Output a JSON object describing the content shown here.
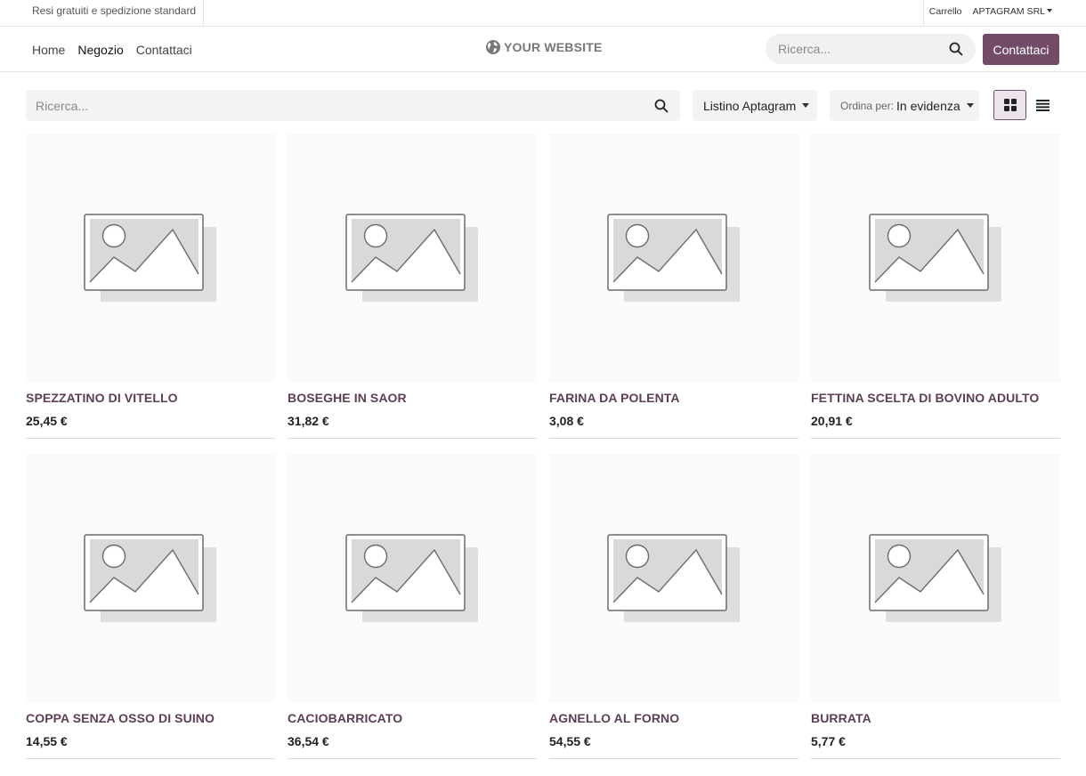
{
  "topbar": {
    "promo": "Resi gratuiti e spedizione standard",
    "cart_link": "Carrello",
    "company": "APTAGRAM SRL"
  },
  "header": {
    "nav": [
      "Home",
      "Negozio",
      "Contattaci"
    ],
    "active_nav": "Negozio",
    "logo_text": "YOUR WEBSITE",
    "search_placeholder": "Ricerca...",
    "contact_button": "Contattaci"
  },
  "toolbar": {
    "search_placeholder": "Ricerca...",
    "pricelist": "Listino Aptagram",
    "sort_label": "Ordina per:",
    "sort_value": "In evidenza",
    "view_mode": "grid"
  },
  "products": [
    {
      "name": "SPEZZATINO DI VITELLO",
      "price": "25,45 €"
    },
    {
      "name": "BOSEGHE IN SAOR",
      "price": "31,82 €"
    },
    {
      "name": "FARINA DA POLENTA",
      "price": "3,08 €"
    },
    {
      "name": "FETTINA SCELTA DI BOVINO ADULTO",
      "price": "20,91 €"
    },
    {
      "name": "COPPA SENZA OSSO DI SUINO",
      "price": "14,55 €"
    },
    {
      "name": "CACIOBARRICATO",
      "price": "36,54 €"
    },
    {
      "name": "AGNELLO AL FORNO",
      "price": "54,55 €"
    },
    {
      "name": "BURRATA",
      "price": "5,77 €"
    }
  ],
  "colors": {
    "brand": "#714b67",
    "product_name": "#5e3d55"
  },
  "icons": {
    "search": "search-icon",
    "globe": "globe-icon",
    "grid_view": "grid-view-icon",
    "list_view": "list-view-icon",
    "placeholder": "image-placeholder-icon"
  }
}
